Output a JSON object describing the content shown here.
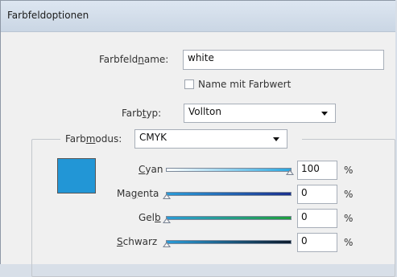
{
  "dialog": {
    "title": "Farbfeldoptionen"
  },
  "swatch_name": {
    "label_pre": "Farbfeld",
    "label_u": "n",
    "label_post": "ame:",
    "value": "white"
  },
  "name_with_value": {
    "label": "Name mit Farbwert",
    "checked": false
  },
  "color_type": {
    "label_pre": "Farb",
    "label_u": "t",
    "label_post": "yp:",
    "value": "Vollton"
  },
  "color_mode": {
    "label_pre": "Farb",
    "label_u": "m",
    "label_post": "odus:",
    "value": "CMYK"
  },
  "swatch_color": "#2296d6",
  "channels": [
    {
      "label_pre": "",
      "label_u": "C",
      "label_post": "yan",
      "value": "100",
      "unit": "%"
    },
    {
      "label_pre": "Ma",
      "label_u": "g",
      "label_post": "enta",
      "value": "0",
      "unit": "%"
    },
    {
      "label_pre": "Gel",
      "label_u": "b",
      "label_post": "",
      "value": "0",
      "unit": "%"
    },
    {
      "label_pre": "",
      "label_u": "S",
      "label_post": "chwarz",
      "value": "0",
      "unit": "%"
    }
  ]
}
